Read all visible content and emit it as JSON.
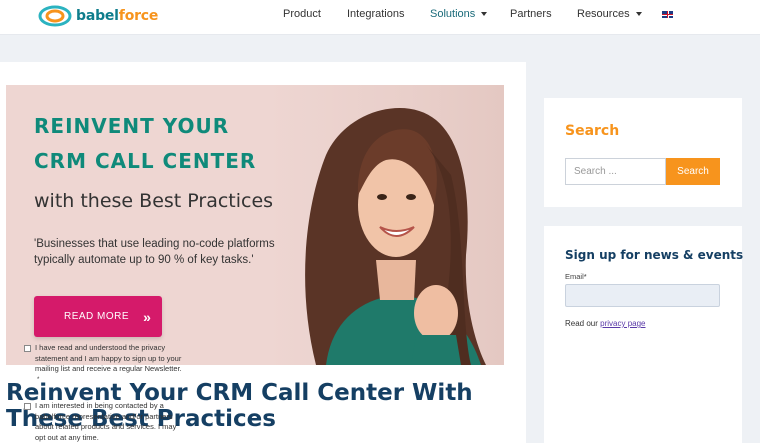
{
  "header": {
    "logo_text_1": "babel",
    "logo_text_2": "force",
    "nav": [
      "Product",
      "Integrations",
      "Solutions",
      "Partners",
      "Resources"
    ],
    "flag": "uk-flag-icon"
  },
  "hero": {
    "title_line1": "REINVENT YOUR",
    "title_line2": "CRM CALL CENTER",
    "subtitle": "with these Best Practices",
    "quote": "'Businesses that use leading no-code platforms typically automate up to 90 % of key tasks.'",
    "button_label": "READ MORE",
    "button_icon": "double-chevron-right-icon",
    "accent_color": "#0f8a7a",
    "button_color": "#d51a6a"
  },
  "article": {
    "title": "Reinvent Your CRM Call Center With These Best Practices"
  },
  "search": {
    "title": "Search",
    "placeholder": "Search ...",
    "button_label": "Search"
  },
  "signup": {
    "title": "Sign up for news & events",
    "email_label": "Email",
    "required_mark": "*",
    "privacy_prefix": "Read our ",
    "privacy_link": "privacy page",
    "consent1": "I have read and understood the privacy statement and I am happy to sign up to your mailing list and receive a regular Newsletter.",
    "consent1_mark": "*",
    "consent2": "I am interested in being contacted by a babelforce representative and/or partners about related products and services. I may opt out at any time."
  }
}
